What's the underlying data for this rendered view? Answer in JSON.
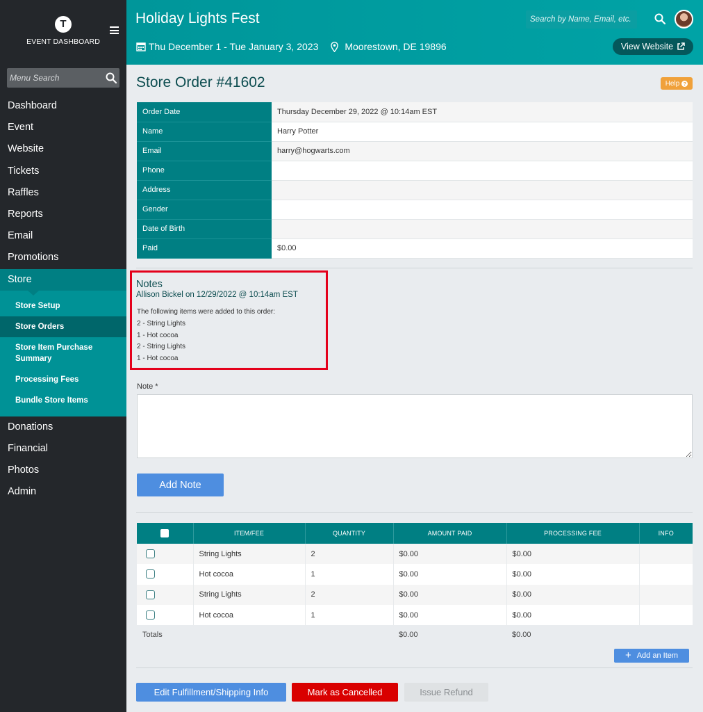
{
  "sidebar": {
    "logo_letter": "T",
    "brand": "EVENT DASHBOARD",
    "menu_search_placeholder": "Menu Search",
    "items": [
      {
        "label": "Dashboard"
      },
      {
        "label": "Event"
      },
      {
        "label": "Website"
      },
      {
        "label": "Tickets"
      },
      {
        "label": "Raffles"
      },
      {
        "label": "Reports"
      },
      {
        "label": "Email"
      },
      {
        "label": "Promotions"
      },
      {
        "label": "Store"
      },
      {
        "label": "Donations"
      },
      {
        "label": "Financial"
      },
      {
        "label": "Photos"
      },
      {
        "label": "Admin"
      }
    ],
    "store_sub": [
      {
        "label": "Store Setup"
      },
      {
        "label": "Store Orders"
      },
      {
        "label": "Store Item Purchase Summary"
      },
      {
        "label": "Processing Fees"
      },
      {
        "label": "Bundle Store Items"
      }
    ]
  },
  "header": {
    "event_title": "Holiday Lights Fest",
    "dates": "Thu December 1 - Tue January 3, 2023",
    "location": "Moorestown, DE 19896",
    "search_placeholder": "Search by Name, Email, etc.",
    "view_website": "View Website"
  },
  "main": {
    "page_title": "Store Order #41602",
    "help": "Help",
    "order_info": [
      {
        "label": "Order Date",
        "value": "Thursday December 29, 2022 @ 10:14am EST"
      },
      {
        "label": "Name",
        "value": "Harry Potter"
      },
      {
        "label": "Email",
        "value": "harry@hogwarts.com"
      },
      {
        "label": "Phone",
        "value": ""
      },
      {
        "label": "Address",
        "value": ""
      },
      {
        "label": "Gender",
        "value": ""
      },
      {
        "label": "Date of Birth",
        "value": ""
      },
      {
        "label": "Paid",
        "value": "$0.00"
      }
    ],
    "notes": {
      "title": "Notes",
      "author_line": "Allison Bickel on 12/29/2022 @ 10:14am EST",
      "lines": [
        "The following items were added to this order:",
        "2 - String Lights",
        "1 - Hot cocoa",
        "2 - String Lights",
        "1 - Hot cocoa"
      ]
    },
    "note_label": "Note *",
    "add_note": "Add Note",
    "items_table": {
      "headers": [
        "ITEM/FEE",
        "QUANTITY",
        "AMOUNT PAID",
        "PROCESSING FEE",
        "INFO"
      ],
      "rows": [
        {
          "item": "String Lights",
          "qty": "2",
          "paid": "$0.00",
          "fee": "$0.00",
          "info": ""
        },
        {
          "item": "Hot cocoa",
          "qty": "1",
          "paid": "$0.00",
          "fee": "$0.00",
          "info": ""
        },
        {
          "item": "String Lights",
          "qty": "2",
          "paid": "$0.00",
          "fee": "$0.00",
          "info": ""
        },
        {
          "item": "Hot cocoa",
          "qty": "1",
          "paid": "$0.00",
          "fee": "$0.00",
          "info": ""
        }
      ],
      "totals": {
        "label": "Totals",
        "paid": "$0.00",
        "fee": "$0.00"
      }
    },
    "add_item": "Add an Item",
    "buttons": {
      "edit_fulfillment": "Edit Fulfillment/Shipping Info",
      "mark_cancelled": "Mark as Cancelled",
      "issue_refund": "Issue Refund"
    }
  },
  "colors": {
    "teal": "#007f83",
    "header_teal": "#00a3a6",
    "sidebar_dark": "#24272b",
    "primary_blue": "#4e8ee0",
    "danger_red": "#d90000",
    "help_orange": "#f0a13a",
    "highlight_red": "#e4001b"
  }
}
